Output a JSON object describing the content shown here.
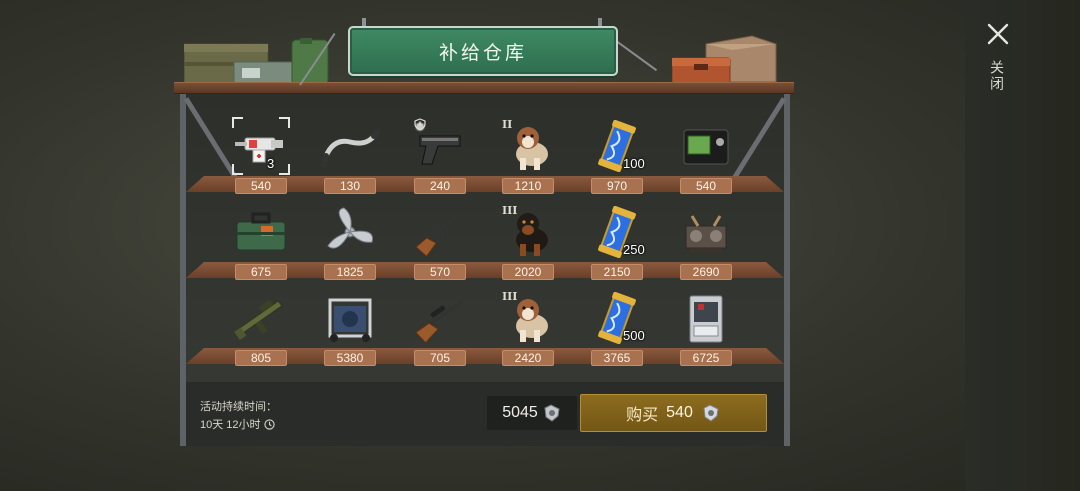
{
  "title": "补给仓库",
  "close": {
    "label": "关闭",
    "icon": "close-x-icon"
  },
  "shelves": [
    [
      {
        "icon": "medkit-syringe-icon",
        "price": "540",
        "tier": "",
        "qty": "3",
        "selected": true
      },
      {
        "icon": "bike-handlebar-icon",
        "price": "130",
        "tier": "",
        "qty": "",
        "selected": false
      },
      {
        "icon": "pistol-icon",
        "price": "240",
        "tier": "shield",
        "qty": "",
        "selected": false
      },
      {
        "icon": "saint-bernard-dog-icon",
        "price": "1210",
        "tier": "II",
        "qty": "",
        "selected": false
      },
      {
        "icon": "dna-capsule-icon",
        "price": "970",
        "tier": "",
        "qty": "100",
        "selected": false
      },
      {
        "icon": "wallet-card-icon",
        "price": "540",
        "tier": "",
        "qty": "",
        "selected": false
      }
    ],
    [
      {
        "icon": "toolbox-icon",
        "price": "675",
        "tier": "",
        "qty": "",
        "selected": false
      },
      {
        "icon": "propeller-icon",
        "price": "1825",
        "tier": "",
        "qty": "",
        "selected": false
      },
      {
        "icon": "rifle-icon",
        "price": "570",
        "tier": "",
        "qty": "",
        "selected": false
      },
      {
        "icon": "rottweiler-dog-icon",
        "price": "2020",
        "tier": "III",
        "qty": "",
        "selected": false
      },
      {
        "icon": "dna-capsule-icon",
        "price": "2150",
        "tier": "",
        "qty": "250",
        "selected": false
      },
      {
        "icon": "engine-parts-icon",
        "price": "2690",
        "tier": "",
        "qty": "",
        "selected": false
      }
    ],
    [
      {
        "icon": "assault-rifle-icon",
        "price": "805",
        "tier": "",
        "qty": "",
        "selected": false
      },
      {
        "icon": "generator-icon",
        "price": "5380",
        "tier": "",
        "qty": "",
        "selected": false
      },
      {
        "icon": "sniper-rifle-icon",
        "price": "705",
        "tier": "",
        "qty": "",
        "selected": false
      },
      {
        "icon": "saint-bernard-dog-icon",
        "price": "2420",
        "tier": "III",
        "qty": "",
        "selected": false
      },
      {
        "icon": "dna-capsule-icon",
        "price": "3765",
        "tier": "",
        "qty": "500",
        "selected": false
      },
      {
        "icon": "vending-machine-icon",
        "price": "6725",
        "tier": "",
        "qty": "",
        "selected": false
      }
    ]
  ],
  "footer": {
    "duration_label": "活动持续时间：",
    "duration_value": "10天 12小时",
    "balance": "5045",
    "buy_label": "购买",
    "buy_price": "540",
    "currency_icon": "gear-part-icon"
  },
  "colors": {
    "sign": "#3f8a64",
    "buy_button": "#8d6c1e",
    "price_tag": "#a8714f"
  }
}
